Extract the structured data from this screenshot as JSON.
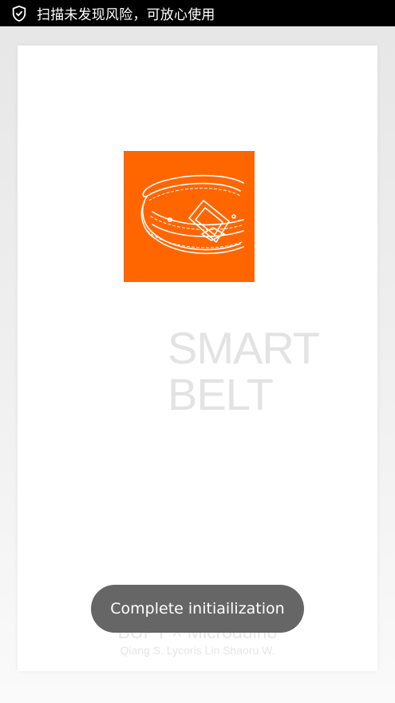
{
  "status_bar": {
    "icon": "shield-check-icon",
    "text": "扫描未发现风险，可放心使用"
  },
  "splash": {
    "logo_icon": "belt-icon",
    "logo_color": "#ff6600",
    "title_line1": "SMART",
    "title_line2": "BELT",
    "org_line": "BUPT × Microduino",
    "authors_line": "Qiang S.  Lycoris Lin  Shaoru W."
  },
  "toast": {
    "message": "Complete initiailization"
  }
}
